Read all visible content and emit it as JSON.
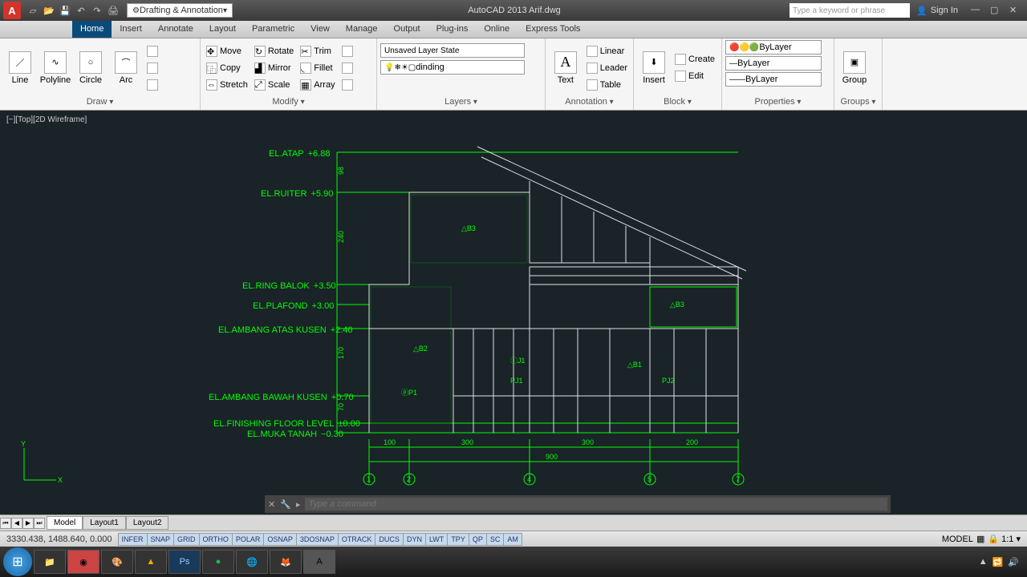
{
  "title": "AutoCAD 2013   Arif.dwg",
  "workspace": "Drafting & Annotation",
  "search_placeholder": "Type a keyword or phrase",
  "signin": "Sign In",
  "tabs": [
    "Home",
    "Insert",
    "Annotate",
    "Layout",
    "Parametric",
    "View",
    "Manage",
    "Output",
    "Plug-ins",
    "Online",
    "Express Tools"
  ],
  "ribbon": {
    "draw": {
      "label": "Draw",
      "items": [
        "Line",
        "Polyline",
        "Circle",
        "Arc"
      ]
    },
    "modify": {
      "label": "Modify",
      "items": [
        "Move",
        "Rotate",
        "Trim",
        "Copy",
        "Mirror",
        "Fillet",
        "Stretch",
        "Scale",
        "Array"
      ]
    },
    "layers": {
      "label": "Layers",
      "state": "Unsaved Layer State",
      "current": "dinding"
    },
    "annotation": {
      "label": "Annotation",
      "text": "Text",
      "items": [
        "Linear",
        "Leader",
        "Table"
      ]
    },
    "block": {
      "label": "Block",
      "insert": "Insert",
      "items": [
        "Create",
        "Edit"
      ]
    },
    "properties": {
      "label": "Properties",
      "bylayer": "ByLayer"
    },
    "groups": {
      "label": "Groups",
      "group": "Group"
    }
  },
  "viewport": "[−][Top][2D Wireframe]",
  "drawing": {
    "elev_labels": [
      {
        "text": "EL.ATAP",
        "val": "+6.88"
      },
      {
        "text": "EL.RUITER",
        "val": "+5.90"
      },
      {
        "text": "EL.RING BALOK",
        "val": "+3.50"
      },
      {
        "text": "EL.PLAFOND",
        "val": "+3.00"
      },
      {
        "text": "EL.AMBANG ATAS KUSEN",
        "val": "+2.40"
      },
      {
        "text": "EL.AMBANG BAWAH KUSEN",
        "val": "+0.70"
      },
      {
        "text": "EL.FINISHING FLOOR LEVEL",
        "val": "±0.00"
      },
      {
        "text": "EL.MUKA TANAH",
        "val": "−0.30"
      }
    ],
    "vdims": [
      "98",
      "240",
      "170",
      "70"
    ],
    "hdims": [
      "100",
      "300",
      "300",
      "200"
    ],
    "total": "900",
    "grids": [
      "1",
      "2",
      "4",
      "5",
      "7"
    ],
    "tags": [
      "B3",
      "B2",
      "J1",
      "B1",
      "PJ1",
      "PJ2",
      "B3",
      "P1"
    ]
  },
  "command_placeholder": "Type a command",
  "layout_tabs": [
    "Model",
    "Layout1",
    "Layout2"
  ],
  "coords": "3330.438, 1488.640, 0.000",
  "status_toggles": [
    "INFER",
    "SNAP",
    "GRID",
    "ORTHO",
    "POLAR",
    "OSNAP",
    "3DOSNAP",
    "OTRACK",
    "DUCS",
    "DYN",
    "LWT",
    "TPY",
    "QP",
    "SC",
    "AM"
  ],
  "status_right": {
    "model": "MODEL",
    "scale": "1:1"
  },
  "tray": {
    "time": "",
    "date": ""
  }
}
